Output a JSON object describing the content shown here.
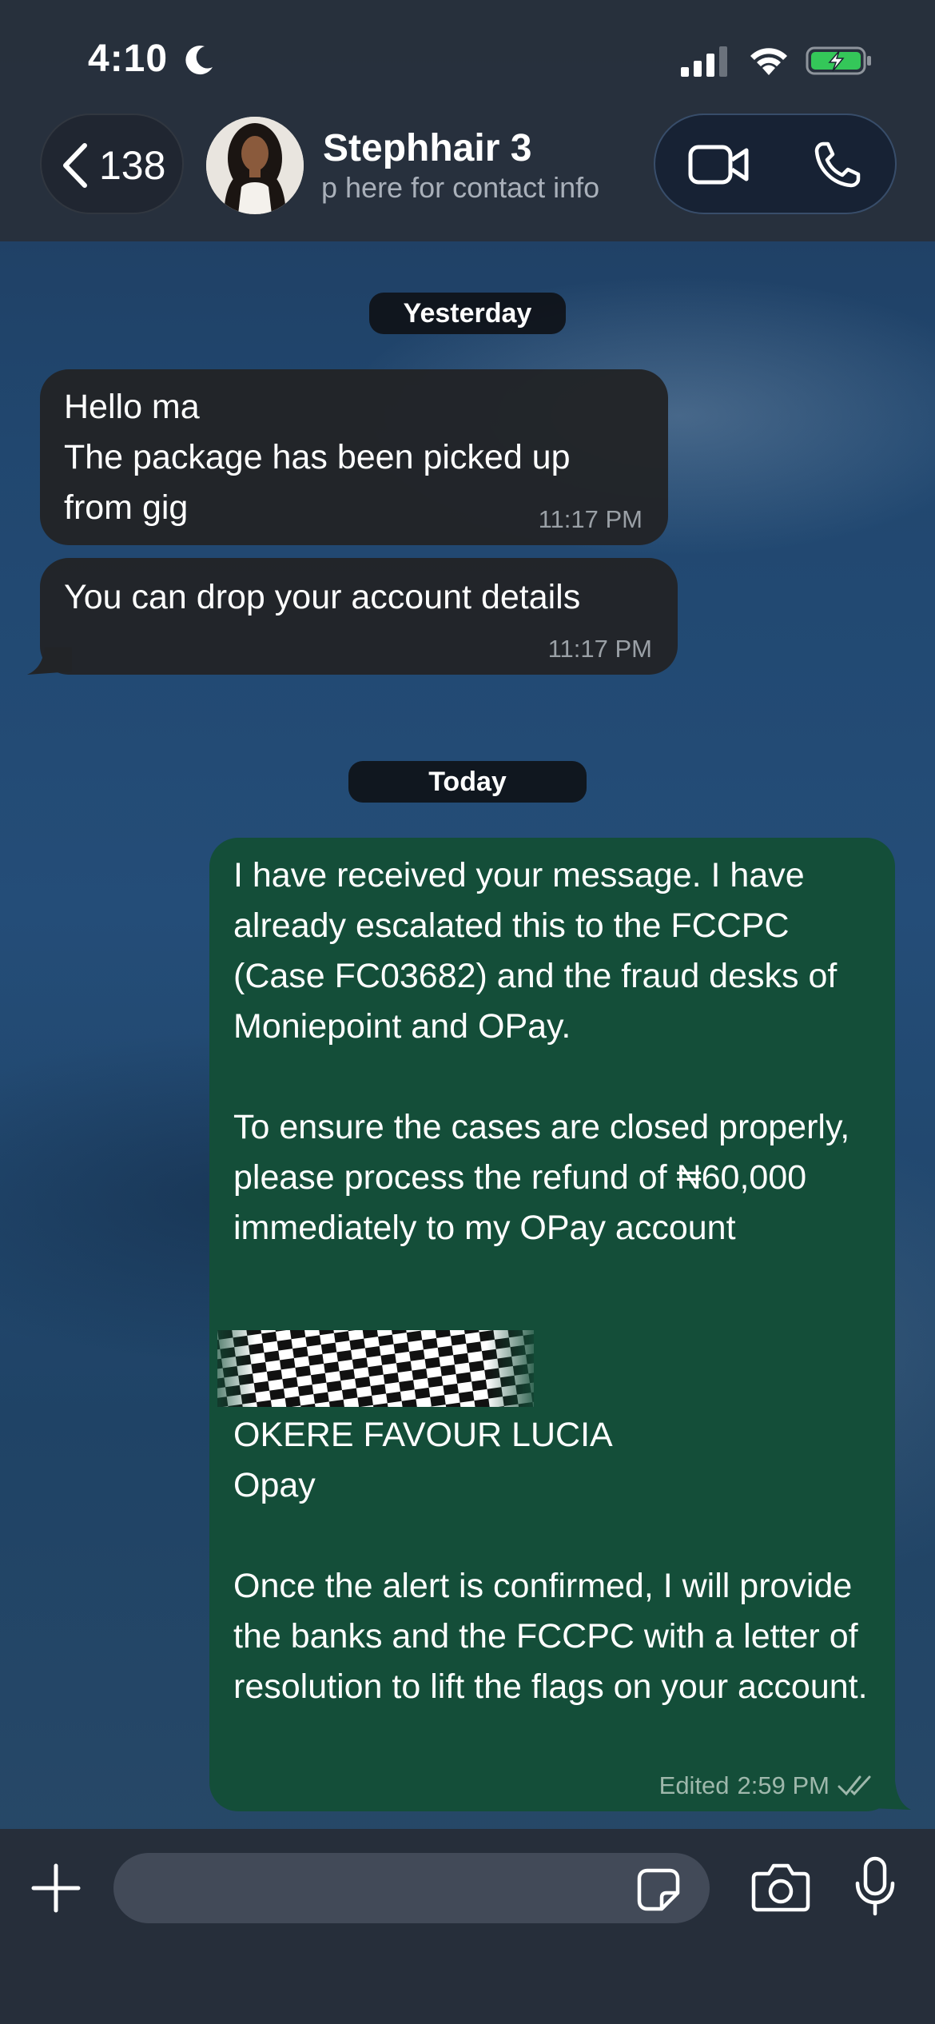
{
  "status_bar": {
    "time": "4:10",
    "icons": [
      "moon-icon",
      "signal-icon",
      "wifi-icon",
      "battery-charging-icon"
    ]
  },
  "header": {
    "back_count": "138",
    "contact_name": "Stephhair 3",
    "contact_subtitle": "p here for contact info",
    "actions": [
      "video-call-icon",
      "voice-call-icon"
    ]
  },
  "messages": {
    "date_yesterday": "Yesterday",
    "incoming": [
      {
        "text": "Hello ma\nThe package has been picked up from gig",
        "time": "11:17 PM"
      },
      {
        "text": "You can drop your account details",
        "time": "11:17 PM"
      }
    ],
    "date_today": "Today",
    "outgoing": {
      "text_part1": "I have received your message. I have already escalated this to the FCCPC (Case FC03682) and the fraud desks of Moniepoint and OPay.\n\nTo ensure the cases are closed properly, please process the refund of ₦60,000 immediately to my OPay account",
      "text_part2": "OKERE FAVOUR LUCIA\nOpay\n\nOnce the alert is confirmed, I will provide the banks and the FCCPC with a letter of resolution to lift the flags on your account.",
      "edited_label": "Edited",
      "time": "2:59 PM",
      "status_icon": "double-check-icon"
    }
  },
  "composer": {
    "icons": [
      "plus-icon",
      "sticker-icon",
      "camera-icon",
      "microphone-icon"
    ]
  },
  "colors": {
    "outgoing_bubble": "#144e39",
    "incoming_bubble": "#222427",
    "header_bg": "#282f3a",
    "battery_fill": "#34c759"
  }
}
